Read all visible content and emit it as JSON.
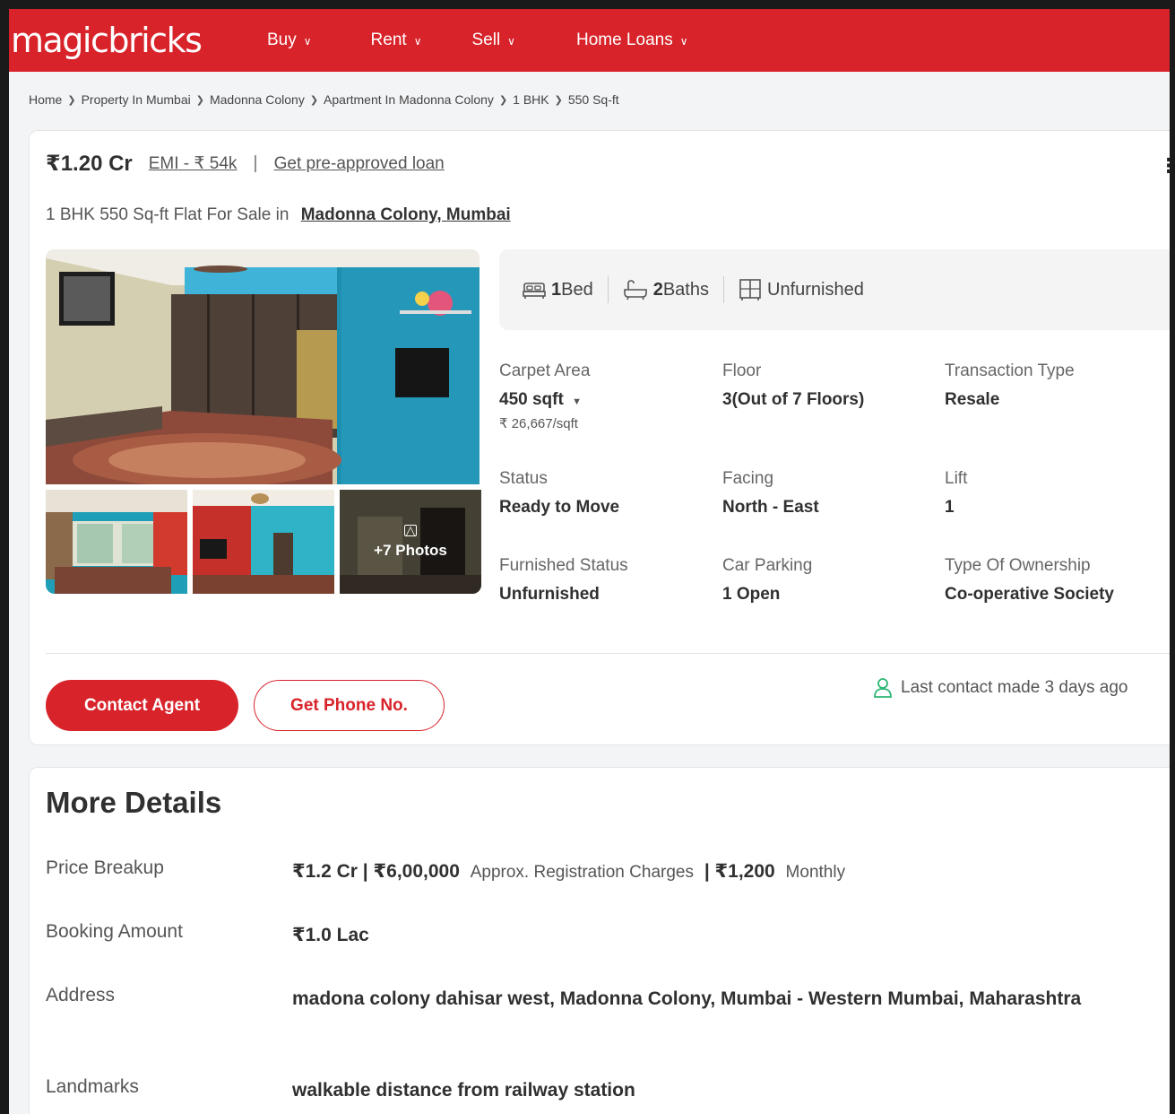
{
  "header": {
    "logo": "magicbricks",
    "nav": [
      {
        "label": "Buy"
      },
      {
        "label": "Rent"
      },
      {
        "label": "Sell"
      },
      {
        "label": "Home Loans"
      }
    ]
  },
  "breadcrumb": [
    "Home",
    "Property In Mumbai",
    "Madonna Colony",
    "Apartment In Madonna Colony",
    "1 BHK",
    "550 Sq-ft"
  ],
  "listing": {
    "price": "₹1.20 Cr",
    "emi": "EMI - ₹ 54k",
    "separator": "|",
    "loan_link": "Get pre-approved loan",
    "title_prefix": "1 BHK 550 Sq-ft Flat For Sale in",
    "location": "Madonna Colony, Mumbai",
    "photos_more": "+7 Photos"
  },
  "amenities": {
    "bed_count": "1",
    "bed_label": "Bed",
    "bath_count": "2",
    "bath_label": "Baths",
    "furnishing": "Unfurnished"
  },
  "details": {
    "carpet_area": {
      "label": "Carpet Area",
      "value": "450 sqft",
      "sub": "₹ 26,667/sqft"
    },
    "floor": {
      "label": "Floor",
      "value": "3(Out of 7 Floors)"
    },
    "transaction_type": {
      "label": "Transaction Type",
      "value": "Resale"
    },
    "status": {
      "label": "Status",
      "value": "Ready to Move"
    },
    "facing": {
      "label": "Facing",
      "value": "North - East"
    },
    "lift": {
      "label": "Lift",
      "value": "1"
    },
    "furnished_status": {
      "label": "Furnished Status",
      "value": "Unfurnished"
    },
    "car_parking": {
      "label": "Car Parking",
      "value": "1 Open"
    },
    "ownership": {
      "label": "Type Of Ownership",
      "value": "Co-operative Society"
    }
  },
  "actions": {
    "contact_agent": "Contact Agent",
    "get_phone": "Get Phone No.",
    "last_contact": "Last contact made 3 days ago"
  },
  "more_details": {
    "title": "More Details",
    "price_breakup": {
      "label": "Price Breakup",
      "price": "₹1.2 Cr | ₹6,00,000",
      "registration": "Approx. Registration Charges",
      "maintenance": "| ₹1,200",
      "period": "Monthly"
    },
    "booking_amount": {
      "label": "Booking Amount",
      "value": "₹1.0 Lac"
    },
    "address": {
      "label": "Address",
      "value": "madona colony dahisar west, Madonna Colony, Mumbai - Western Mumbai, Maharashtra"
    },
    "landmarks": {
      "label": "Landmarks",
      "value": "walkable distance from railway station"
    }
  }
}
